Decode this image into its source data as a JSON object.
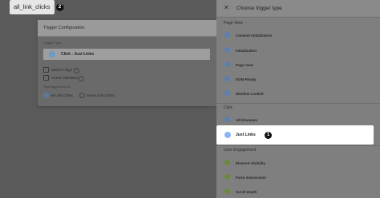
{
  "left": {
    "tag_name": "all_link_clicks",
    "badge2": "2",
    "card": {
      "title": "Trigger Configuration",
      "trigger_type_label": "Trigger Type",
      "trigger_type_value": "Click - Just Links",
      "wait_for_tags": "Wait for Tags",
      "check_validation": "Check Validation",
      "fires_on_label": "This trigger fires on",
      "all_link_clicks": "All Link Clicks",
      "some_link_clicks": "Some Link Clicks"
    }
  },
  "panel": {
    "title": "Choose trigger type",
    "sections": {
      "page_view": "Page View",
      "click": "Click",
      "user_engagement": "User Engagement"
    },
    "page_view_items": [
      "Consent Initialization",
      "Initialization",
      "Page View",
      "DOM Ready",
      "Window Loaded"
    ],
    "click_items": [
      "All Elements",
      "Just Links"
    ],
    "engagement_items": [
      "Element Visibility",
      "Form Submission",
      "Scroll Depth"
    ],
    "badge1": "1"
  },
  "colors": {
    "accent_blue": "#8ab4f8",
    "green_icon": "#7cb342"
  }
}
